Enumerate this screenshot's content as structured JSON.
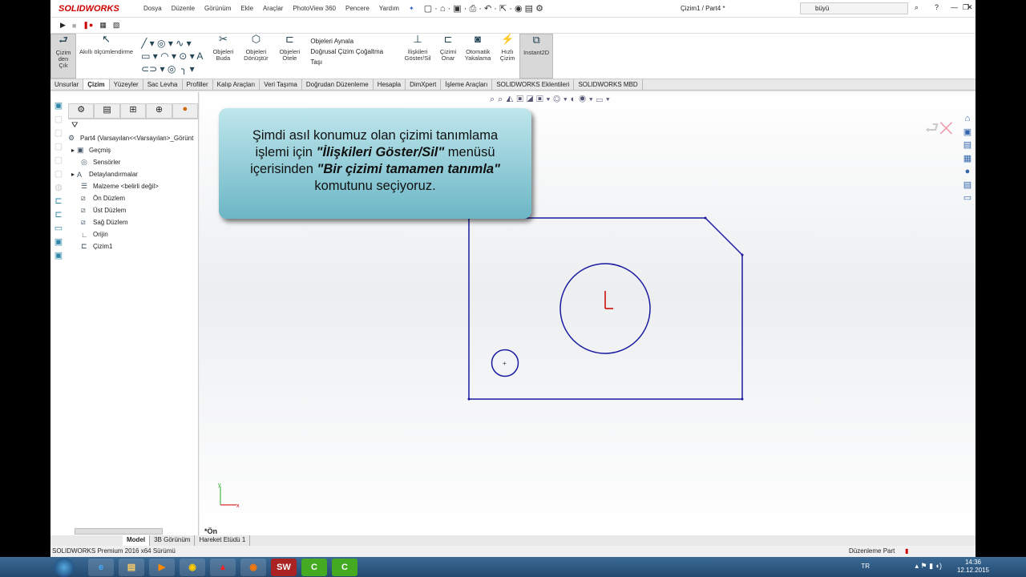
{
  "app": {
    "brand": "SOLIDWORKS",
    "doc_title": "Çizim1 / Part4 *",
    "search_value": "büyü"
  },
  "menu": [
    "Dosya",
    "Düzenle",
    "Görünüm",
    "Ekle",
    "Araçlar",
    "PhotoView 360",
    "Pencere",
    "Yardım"
  ],
  "commands": {
    "exit_sketch": "Çizim den Çık",
    "smart_dim": "Akıllı ölçümlendirme",
    "trim": "Objeleri Buda",
    "convert": "Objeleri Dönüştür",
    "offset": "Objeleri Ötele",
    "mirror": "Objeleri Aynala",
    "linear_pattern": "Doğrusal Çizim Çoğaltma",
    "move": "Taşı",
    "relations": "İlişkileri Göster/Sil",
    "repair": "Çizimi Onar",
    "snap": "Otomatik Yakalama",
    "rapid": "Hızlı Çizim",
    "instant2d": "Instant2D"
  },
  "tabs": [
    "Unsurlar",
    "Çizim",
    "Yüzeyler",
    "Sac Levha",
    "Profiller",
    "Kalıp Araçları",
    "Veri Taşıma",
    "Doğrudan Düzenleme",
    "Hesapla",
    "DimXpert",
    "İşleme Araçları",
    "SOLIDWORKS Eklentileri",
    "SOLIDWORKS MBD"
  ],
  "tree": [
    {
      "label": "Part4  (Varsayılan<<Varsayılan>_Görünt",
      "icon": "part-icon"
    },
    {
      "label": "Geçmiş",
      "icon": "history-icon"
    },
    {
      "label": "Sensörler",
      "icon": "sensor-icon"
    },
    {
      "label": "Detaylandırmalar",
      "icon": "annotation-icon"
    },
    {
      "label": "Malzeme <belirli değil>",
      "icon": "material-icon"
    },
    {
      "label": "Ön Düzlem",
      "icon": "plane-icon"
    },
    {
      "label": "Üst Düzlem",
      "icon": "plane-icon"
    },
    {
      "label": "Sağ Düzlem",
      "icon": "plane-icon"
    },
    {
      "label": "Orijin",
      "icon": "origin-icon"
    },
    {
      "label": "Çizim1",
      "icon": "sketch-icon"
    }
  ],
  "callout": {
    "p1": "Şimdi asıl konumuz olan çizimi tanımlama işlemi için ",
    "b1": "\"İlişkileri Göster/Sil\"",
    "p2": " menüsü içerisinden ",
    "b2": "\"Bir çizimi tamamen tanımla\"",
    "p3": " komutunu seçiyoruz."
  },
  "view_label": "*Ön",
  "bottom_tabs": [
    "Model",
    "3B Görünüm",
    "Hareket Etüdü 1"
  ],
  "status": {
    "left": "SOLIDWORKS Premium 2016 x64 Sürümü",
    "right": "Düzenleme Part"
  },
  "taskbar": {
    "lang": "TR",
    "time": "14:36",
    "date": "12.12.2015"
  },
  "colors": {
    "sketch": "#1a1aa0",
    "accent": "#c00000"
  }
}
